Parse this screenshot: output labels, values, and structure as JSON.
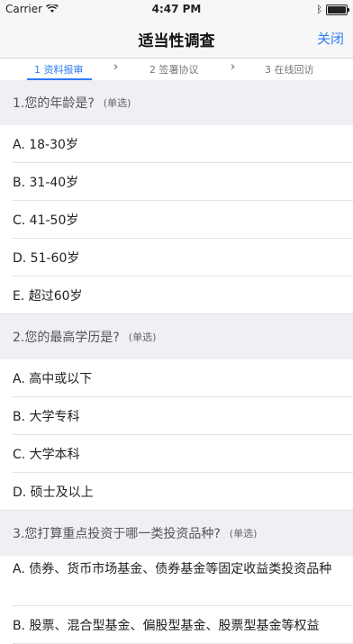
{
  "status_bar": {
    "carrier": "Carrier",
    "time": "4:47 PM"
  },
  "nav": {
    "title": "适当性调查",
    "close_label": "关闭"
  },
  "steps": [
    {
      "label": "1 资料报审"
    },
    {
      "label": "2 签署协议"
    },
    {
      "label": "3 在线回访"
    }
  ],
  "questions": [
    {
      "title": "1.您的年龄是?",
      "type": "(单选)",
      "options": [
        "A. 18-30岁",
        "B. 31-40岁",
        "C. 41-50岁",
        "D. 51-60岁",
        "E. 超过60岁"
      ]
    },
    {
      "title": "2.您的最高学历是?",
      "type": "(单选)",
      "options": [
        "A. 高中或以下",
        "B. 大学专科",
        "C. 大学本科",
        "D. 硕士及以上"
      ]
    },
    {
      "title": "3.您打算重点投资于哪一类投资品种?",
      "type": "(单选)",
      "options": [
        "A. 债券、货币市场基金、债券基金等固定收益类投资品种",
        "B. 股票、混合型基金、偏股型基金、股票型基金等权益"
      ]
    }
  ],
  "colors": {
    "accent": "#2f7bf5",
    "section_bg": "#efeff4"
  }
}
